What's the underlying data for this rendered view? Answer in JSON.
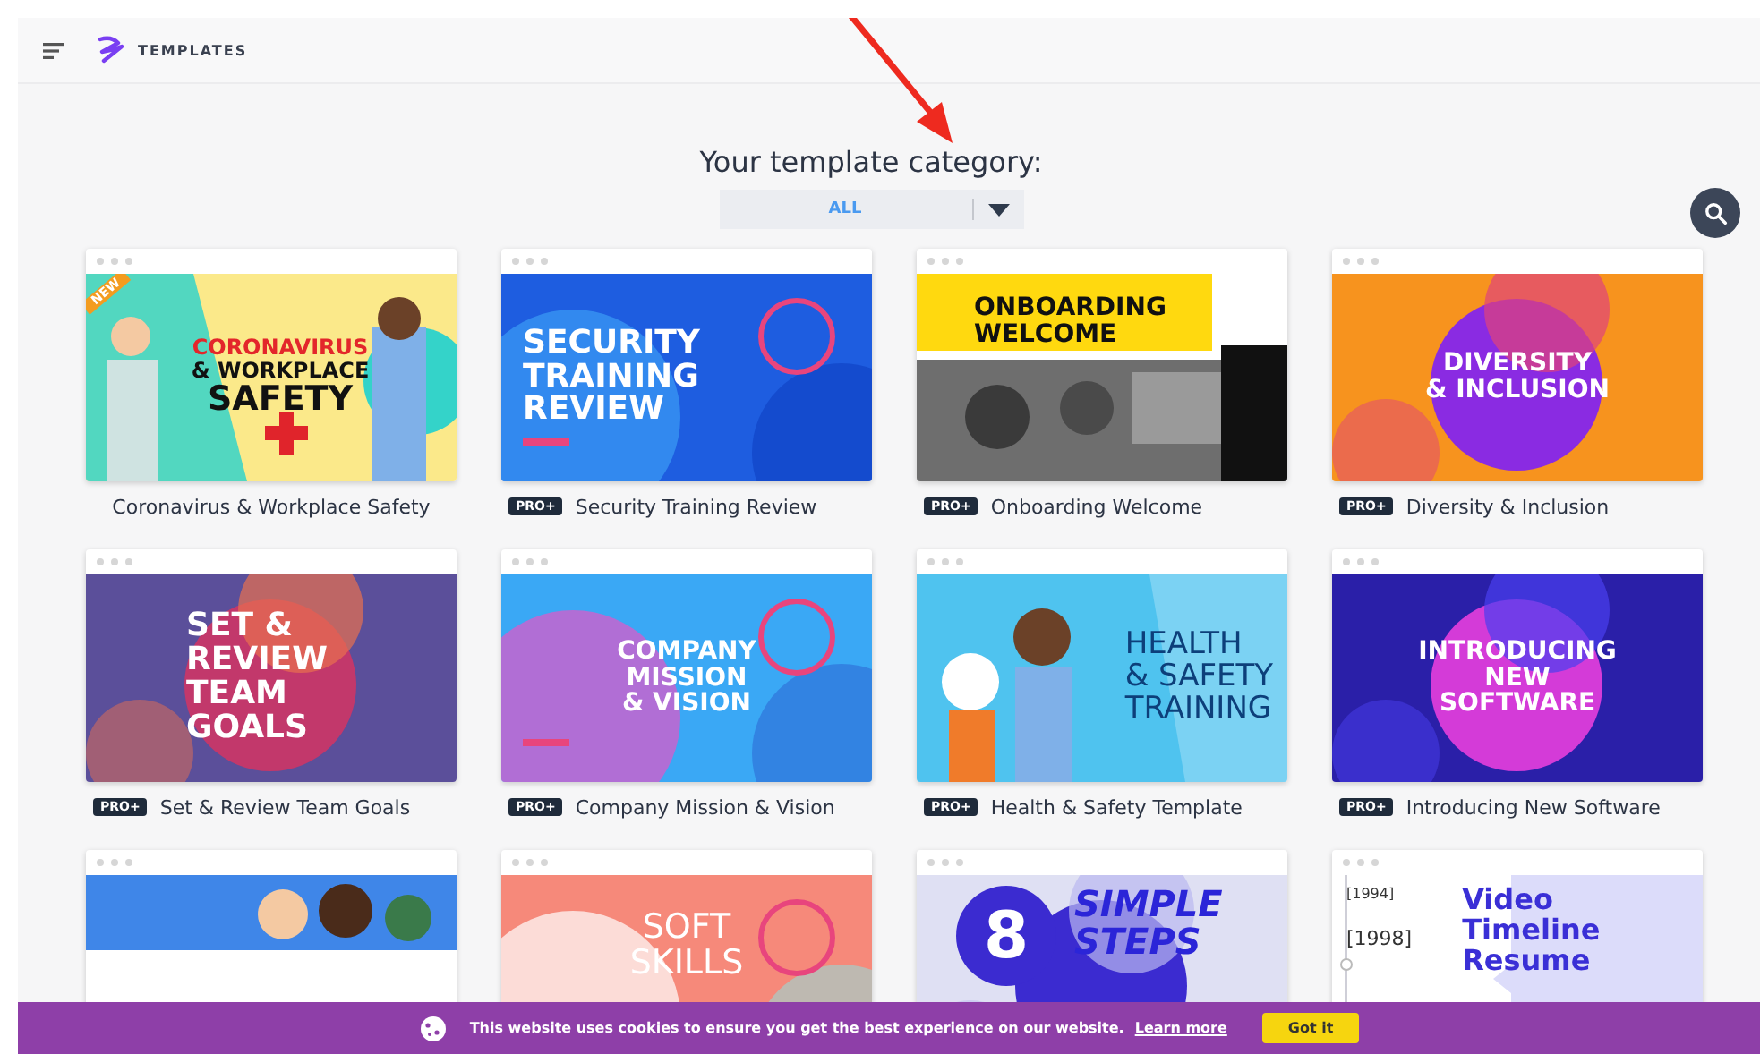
{
  "header": {
    "logo_text": "TEMPLATES"
  },
  "heading": "Your template category:",
  "category_select": {
    "value": "ALL"
  },
  "templates": [
    {
      "title": "Coronavirus & Workplace Safety",
      "color": "#fbe98a",
      "ribbon": "NEW",
      "slide_lines": [
        "CORONAVIRUS",
        "& WORKPLACE",
        "SAFETY"
      ]
    },
    {
      "title": "Security Training Review",
      "color": "#1e5de0",
      "badge": "PRO+",
      "slide_lines": [
        "SECURITY",
        "TRAINING",
        "REVIEW"
      ]
    },
    {
      "title": "Onboarding Welcome",
      "color": "#ffffff",
      "badge": "PRO+",
      "slide_lines": [
        "ONBOARDING",
        "WELCOME"
      ]
    },
    {
      "title": "Diversity & Inclusion",
      "color": "#f7931e",
      "badge": "PRO+",
      "slide_lines": [
        "DIVERSITY",
        "& INCLUSION"
      ]
    },
    {
      "title": "Set & Review Team Goals",
      "color": "#5b4f9a",
      "badge": "PRO+",
      "slide_lines": [
        "SET &",
        "REVIEW",
        "TEAM",
        "GOALS"
      ]
    },
    {
      "title": "Company Mission & Vision",
      "color": "#3aa8f5",
      "badge": "PRO+",
      "slide_lines": [
        "COMPANY",
        "MISSION",
        "& VISION"
      ]
    },
    {
      "title": "Health & Safety Template",
      "color": "#4fc3ef",
      "badge": "PRO+",
      "slide_lines": [
        "HEALTH",
        "& SAFETY",
        "TRAINING"
      ]
    },
    {
      "title": "Introducing New Software",
      "color": "#2a1fa8",
      "badge": "PRO+",
      "slide_lines": [
        "INTRODUCING",
        "NEW",
        "SOFTWARE"
      ]
    },
    {
      "color": "#3f86e8"
    },
    {
      "color": "#f6897a",
      "slide_lines": [
        "SOFT",
        "SKILLS"
      ]
    },
    {
      "color": "#dfe0f3",
      "number": "8",
      "slide_lines": [
        "SIMPLE",
        "STEPS"
      ]
    },
    {
      "color": "#ffffff",
      "timeline_years": [
        "[1994]",
        "[1998]"
      ],
      "slide_lines": [
        "Video",
        "Timeline",
        "Resume"
      ]
    }
  ],
  "cookie_bar": {
    "message": "This website uses cookies to ensure you get the best experience on our website.",
    "link": "Learn more",
    "button": "Got it"
  }
}
